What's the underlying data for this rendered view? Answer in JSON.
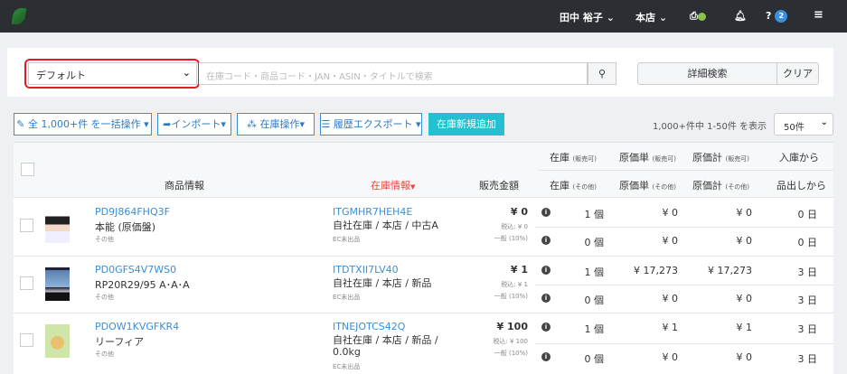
{
  "header": {
    "user": "田中 裕子",
    "store": "本店",
    "help_badge": "2",
    "status_color": "#8bc34a"
  },
  "search": {
    "preset": "デフォルト",
    "placeholder": "在庫コード・商品コード・JAN・ASIN・タイトルで検索",
    "detail_label": "詳細検索",
    "clear_label": "クリア"
  },
  "toolbar": {
    "bulk": "全 1,000+件 を一括操作",
    "import": "インポート",
    "stock_ops": "在庫操作",
    "export": "履歴エクスポート",
    "add_new": "在庫新規追加",
    "count_text": "1,000+件中 1-50件 を表示",
    "per_page": "50件",
    "accent": "#22c0d0"
  },
  "columns": {
    "product": "商品情報",
    "stock_info": "在庫情報",
    "price": "販売金額",
    "stock": "在庫",
    "cost_unit": "原価単",
    "cost_total": "原価計",
    "sellable": "(販売可)",
    "other": "(その他)",
    "days_in": "入庫から",
    "days_out": "品出しから"
  },
  "rows": [
    {
      "code": "PD9J864FHQ3F",
      "name": "本能 (原価盤)",
      "category": "その他",
      "item_code": "ITGMHR7HEH4E",
      "location": "自社在庫 / 本店 / 中古A",
      "ec": "EC未出品",
      "price": "¥ 0",
      "tax_incl": "税込: ¥ 0",
      "tax_type": "一般 (10%)",
      "sellable": {
        "qty": "1 個",
        "unit": "¥ 0",
        "total": "¥ 0",
        "days": "0 日"
      },
      "other": {
        "qty": "0 個",
        "unit": "¥ 0",
        "total": "¥ 0",
        "days": "0 日"
      }
    },
    {
      "code": "PD0GFS4V7WS0",
      "name": "RP20R29/95 A･A･A",
      "category": "その他",
      "item_code": "ITDTXII7LV40",
      "location": "自社在庫 / 本店 / 新品",
      "ec": "EC未出品",
      "price": "¥ 1",
      "tax_incl": "税込: ¥ 1",
      "tax_type": "一般 (10%)",
      "sellable": {
        "qty": "1 個",
        "unit": "¥ 17,273",
        "total": "¥ 17,273",
        "days": "3 日"
      },
      "other": {
        "qty": "0 個",
        "unit": "¥ 0",
        "total": "¥ 0",
        "days": "3 日"
      }
    },
    {
      "code": "PDOW1KVGFKR4",
      "name": "リーフィア",
      "category": "その他",
      "item_code": "ITNEJOTCS42Q",
      "location": "自社在庫 / 本店 / 新品 / 0.0kg",
      "ec": "EC未出品",
      "price": "¥ 100",
      "tax_incl": "税込: ¥ 100",
      "tax_type": "一般 (10%)",
      "sellable": {
        "qty": "1 個",
        "unit": "¥ 1",
        "total": "¥ 1",
        "days": "3 日"
      },
      "other": {
        "qty": "0 個",
        "unit": "¥ 0",
        "total": "¥ 0",
        "days": "3 日"
      }
    }
  ]
}
